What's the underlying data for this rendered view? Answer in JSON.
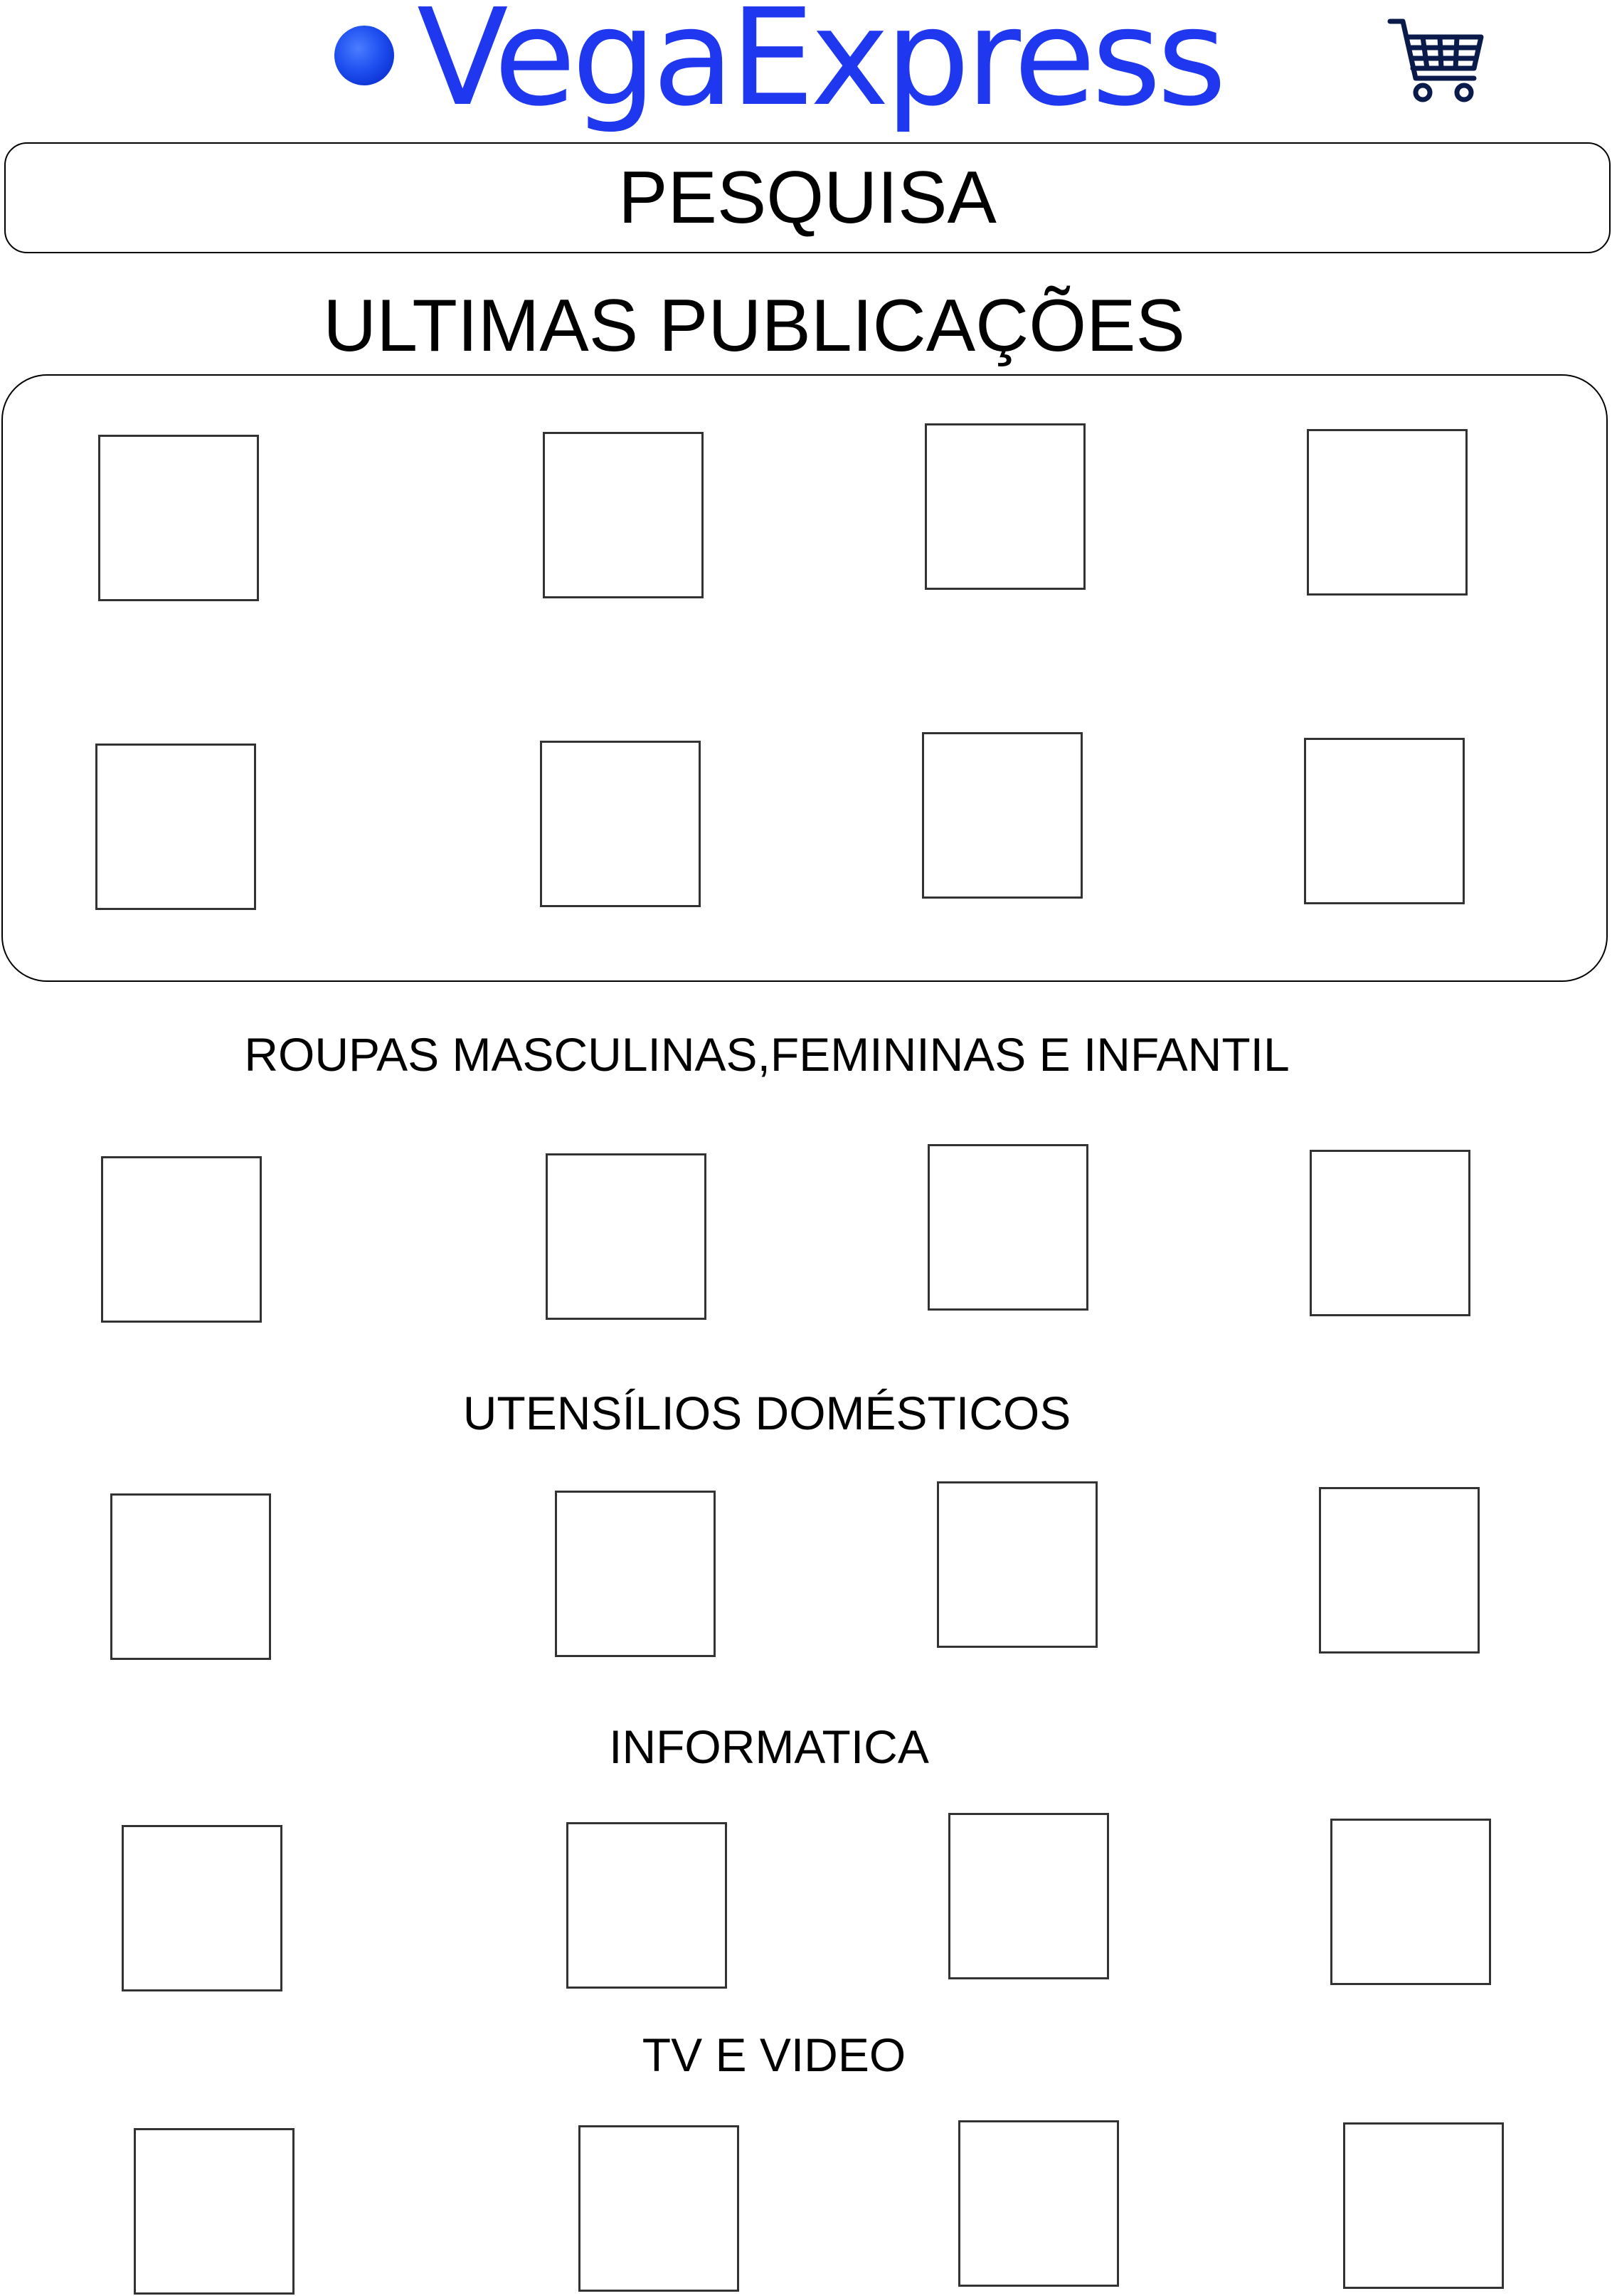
{
  "header": {
    "brand": "VegaExpress",
    "brand_color": "#1f37ee",
    "logo_icon": "globe-dot-icon",
    "cart_icon": "shopping-cart-icon",
    "cart_color": "#0a1a4a"
  },
  "search": {
    "label": "PESQUISA"
  },
  "latest": {
    "title": "ULTIMAS PUBLICAÇÕES",
    "item_count": 8
  },
  "categories": [
    {
      "title": "ROUPAS MASCULINAS,FEMININAS E INFANTIL",
      "item_count": 4
    },
    {
      "title": "UTENSÍLIOS DOMÉSTICOS",
      "item_count": 4
    },
    {
      "title": "INFORMATICA",
      "item_count": 4
    },
    {
      "title": "TV E VIDEO",
      "item_count": 4
    }
  ]
}
